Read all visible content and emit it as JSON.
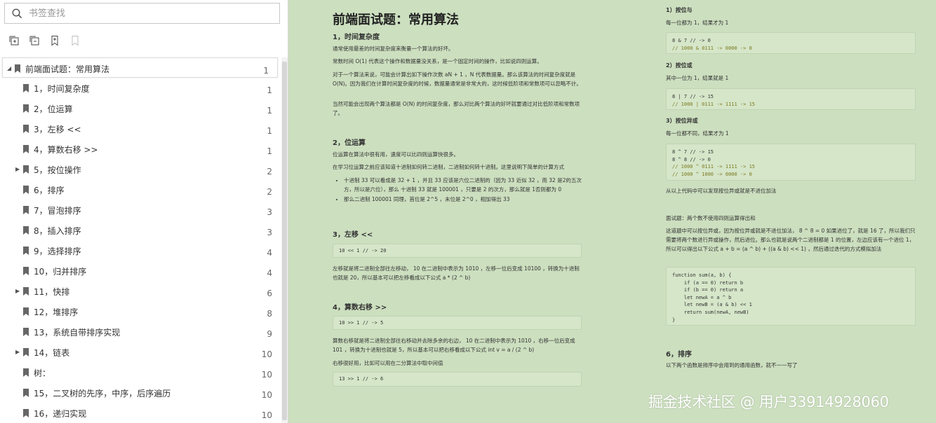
{
  "search": {
    "placeholder": "书签查找"
  },
  "toolbar": [
    {
      "icon": "expand-all-icon",
      "enabled": true
    },
    {
      "icon": "collapse-all-icon",
      "enabled": true
    },
    {
      "icon": "add-bookmark-icon",
      "enabled": true
    },
    {
      "icon": "bookmark-icon",
      "enabled": false
    }
  ],
  "bookmarks": [
    {
      "label": "前端面试题：常用算法",
      "page": "1",
      "level": 0,
      "arrow": "expanded",
      "selected": true
    },
    {
      "label": "1，时间复杂度",
      "page": "1",
      "level": 1,
      "arrow": "none"
    },
    {
      "label": "2，位运算",
      "page": "1",
      "level": 1,
      "arrow": "none"
    },
    {
      "label": "3，左移 <<",
      "page": "1",
      "level": 1,
      "arrow": "none"
    },
    {
      "label": "4，算数右移 >>",
      "page": "1",
      "level": 1,
      "arrow": "none"
    },
    {
      "label": "5，按位操作",
      "page": "2",
      "level": 1,
      "arrow": "collapsed"
    },
    {
      "label": "6，排序",
      "page": "2",
      "level": 1,
      "arrow": "none"
    },
    {
      "label": "7，冒泡排序",
      "page": "3",
      "level": 1,
      "arrow": "none"
    },
    {
      "label": "8，插入排序",
      "page": "3",
      "level": 1,
      "arrow": "none"
    },
    {
      "label": "9，选择排序",
      "page": "4",
      "level": 1,
      "arrow": "none"
    },
    {
      "label": "10，归并排序",
      "page": "4",
      "level": 1,
      "arrow": "none"
    },
    {
      "label": "11，快排",
      "page": "6",
      "level": 1,
      "arrow": "collapsed"
    },
    {
      "label": "12，堆排序",
      "page": "8",
      "level": 1,
      "arrow": "none"
    },
    {
      "label": "13，系统自带排序实现",
      "page": "9",
      "level": 1,
      "arrow": "none"
    },
    {
      "label": "14，链表",
      "page": "10",
      "level": 1,
      "arrow": "collapsed"
    },
    {
      "label": "树：",
      "page": "10",
      "level": 1,
      "arrow": "none"
    },
    {
      "label": "15，二叉树的先序，中序，后序遍历",
      "page": "10",
      "level": 1,
      "arrow": "none"
    },
    {
      "label": "16，递归实现",
      "page": "10",
      "level": 1,
      "arrow": "none"
    }
  ],
  "document": {
    "title": "前端面试题：常用算法",
    "s1": {
      "heading": "1，时间复杂度",
      "p1": "通常使用最差的时间复杂度来衡量一个算法的好坏。",
      "p2": "常数时间 O(1) 代表这个操作和数据量没关系，是一个固定时间的操作，比如说四则运算。",
      "p3": "对于一个算法来说，可能会计算出如下操作次数  aN + 1 ，N 代表数据量。那么该算法的时间复杂度就是 O(N)。因为我们在计算时间复杂度的时候，数据量通常是非常大的，这时候低阶项和常数项可以忽略不计。",
      "p4": "当然可能会出现两个算法都是 O(N) 的时间复杂度，那么对比两个算法的好坏就要通过对比低阶项和常数项了。"
    },
    "s2": {
      "heading": "2，位运算",
      "p1": "位运算在算法中很有用，速度可以比四则运算快很多。",
      "p2": "在学习位运算之前应该知道十进制如何转二进制，二进制如何转十进制。这里说明下简单的计算方式",
      "b1": "十进制  33  可以看成是  32 + 1 ，并且  33  应该是六位二进制的（因为  33  近似  32 ，而  32  是2的五次方，所以是六位），那么 十进制  33  就是  100001 ，只要是 2 的次方，那么就是 1否则都为 0",
      "b2": "那么二进制  100001  同理，首位是  2^5 ，末位是  2^0 ，相加得出 33"
    },
    "s3": {
      "heading": "3，左移 <<",
      "code": "10 << 1 // -> 20",
      "p1": "左移就是将二进制全部往左移动，  10  在二进制中表示为  1010 ，左移一位后变成  10100 ，转换为十进制也就是 20，所以基本可以把左移看成以下公式  a * (2 ^ b)"
    },
    "s4": {
      "heading": "4，算数右移 >>",
      "code": "10 >> 1 // -> 5",
      "p1": "算数右移就是将二进制全部往右移动并去除多余的右边，  10  在二进制中表示为  1010 ，右移一位后变成  101 ，转换为十进制也就是 5，所以基本可以把右移看成以下公式  int v = a / (2 ^ b)",
      "p2": "右移很好用，比如可以用在二分算法中取中间值",
      "code2": "13 >> 1 // -> 6"
    },
    "r1": {
      "heading": "1）按位与",
      "p1": "每一位都为 1，结果才为 1",
      "code_l1": "8 & 7 // -> 0",
      "code_l2": "// 1000 & 0111 -> 0000 -> 0"
    },
    "r2": {
      "heading": "2）按位或",
      "p1": "其中一位为 1，结果就是 1",
      "code_l1": "8 | 7 // -> 15",
      "code_l2": "// 1000 | 0111 -> 1111 -> 15"
    },
    "r3": {
      "heading": "3）按位异或",
      "p1": "每一位都不同，结果才为 1",
      "code_l1": "8 ^ 7 // -> 15",
      "code_l2": "8 ^ 8 // -> 0",
      "code_l3": "// 1000 ^ 0111 -> 1111 -> 15",
      "code_l4": "// 1000 ^ 1000 -> 0000 -> 0",
      "p2": "从以上代码中可以发现按位异或就是不进位加法"
    },
    "r4": {
      "heading": "面试题：两个数不使用四则运算得出和",
      "p1": "这道题中可以按位异或，因为按位异或就是不进位加法， 8 ^ 8 = 0 如果进位了，就是 16 了，所以我们只需要将两个数进行异或操作，然后进位。那么也就是说两个二进制都是 1 的位置，左边应该有一个进位 1，所以可以得出以下公式  a + b = (a ^ b) + ((a & b) << 1) ，然后通过迭代的方式模拟加法",
      "code": [
        "function sum(a, b) {",
        "    if (a == 0) return b",
        "    if (b == 0) return a",
        "    let newA = a ^ b",
        "    let newB = (a & b) << 1",
        "    return sum(newA, newB)",
        "}"
      ]
    },
    "r5": {
      "heading": "6，排序",
      "p1": "以下两个函数是排序中会用到的通用函数，就不一一写了"
    }
  },
  "watermark": "掘金技术社区 @ 用户3391492806​0"
}
